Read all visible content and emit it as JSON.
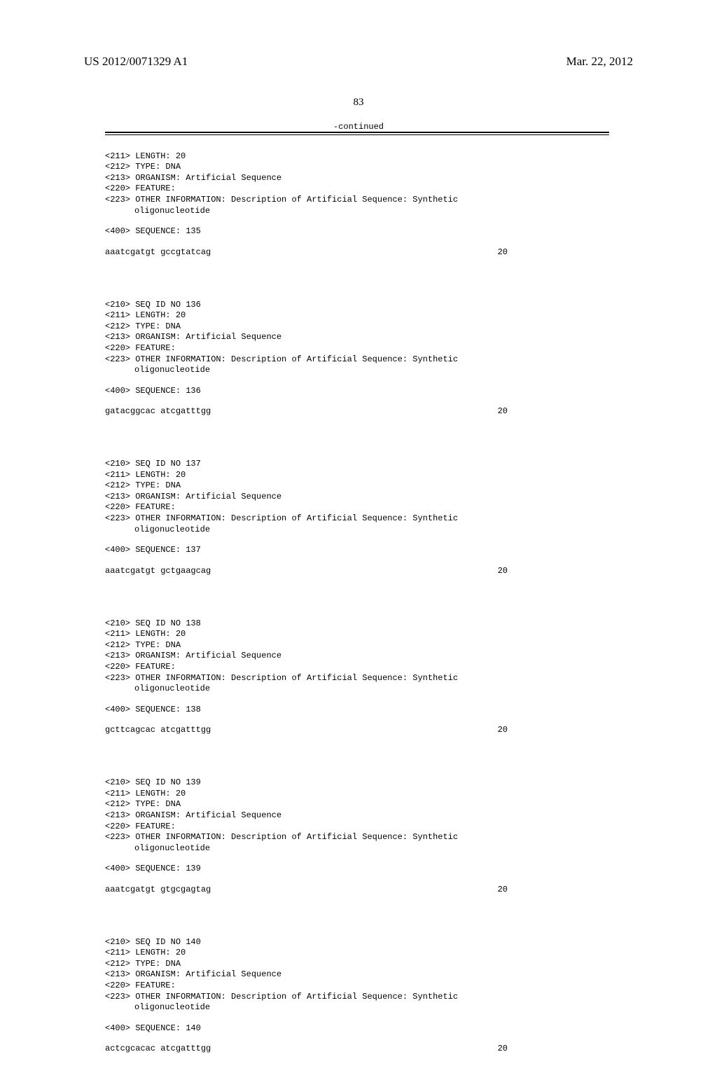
{
  "header": {
    "publication": "US 2012/0071329 A1",
    "date": "Mar. 22, 2012"
  },
  "page_number": "83",
  "continued_label": "-continued",
  "sequences": [
    {
      "has_seq_id": false,
      "length_line": "<211> LENGTH: 20",
      "type_line": "<212> TYPE: DNA",
      "organism_line": "<213> ORGANISM: Artificial Sequence",
      "feature_line": "<220> FEATURE:",
      "other_info_1": "<223> OTHER INFORMATION: Description of Artificial Sequence: Synthetic",
      "other_info_2": "oligonucleotide",
      "sequence_header": "<400> SEQUENCE: 135",
      "sequence_text": "aaatcgatgt gccgtatcag",
      "sequence_length": "20"
    },
    {
      "has_seq_id": true,
      "seq_id_line": "<210> SEQ ID NO 136",
      "length_line": "<211> LENGTH: 20",
      "type_line": "<212> TYPE: DNA",
      "organism_line": "<213> ORGANISM: Artificial Sequence",
      "feature_line": "<220> FEATURE:",
      "other_info_1": "<223> OTHER INFORMATION: Description of Artificial Sequence: Synthetic",
      "other_info_2": "oligonucleotide",
      "sequence_header": "<400> SEQUENCE: 136",
      "sequence_text": "gatacggcac atcgatttgg",
      "sequence_length": "20"
    },
    {
      "has_seq_id": true,
      "seq_id_line": "<210> SEQ ID NO 137",
      "length_line": "<211> LENGTH: 20",
      "type_line": "<212> TYPE: DNA",
      "organism_line": "<213> ORGANISM: Artificial Sequence",
      "feature_line": "<220> FEATURE:",
      "other_info_1": "<223> OTHER INFORMATION: Description of Artificial Sequence: Synthetic",
      "other_info_2": "oligonucleotide",
      "sequence_header": "<400> SEQUENCE: 137",
      "sequence_text": "aaatcgatgt gctgaagcag",
      "sequence_length": "20"
    },
    {
      "has_seq_id": true,
      "seq_id_line": "<210> SEQ ID NO 138",
      "length_line": "<211> LENGTH: 20",
      "type_line": "<212> TYPE: DNA",
      "organism_line": "<213> ORGANISM: Artificial Sequence",
      "feature_line": "<220> FEATURE:",
      "other_info_1": "<223> OTHER INFORMATION: Description of Artificial Sequence: Synthetic",
      "other_info_2": "oligonucleotide",
      "sequence_header": "<400> SEQUENCE: 138",
      "sequence_text": "gcttcagcac atcgatttgg",
      "sequence_length": "20"
    },
    {
      "has_seq_id": true,
      "seq_id_line": "<210> SEQ ID NO 139",
      "length_line": "<211> LENGTH: 20",
      "type_line": "<212> TYPE: DNA",
      "organism_line": "<213> ORGANISM: Artificial Sequence",
      "feature_line": "<220> FEATURE:",
      "other_info_1": "<223> OTHER INFORMATION: Description of Artificial Sequence: Synthetic",
      "other_info_2": "oligonucleotide",
      "sequence_header": "<400> SEQUENCE: 139",
      "sequence_text": "aaatcgatgt gtgcgagtag",
      "sequence_length": "20"
    },
    {
      "has_seq_id": true,
      "seq_id_line": "<210> SEQ ID NO 140",
      "length_line": "<211> LENGTH: 20",
      "type_line": "<212> TYPE: DNA",
      "organism_line": "<213> ORGANISM: Artificial Sequence",
      "feature_line": "<220> FEATURE:",
      "other_info_1": "<223> OTHER INFORMATION: Description of Artificial Sequence: Synthetic",
      "other_info_2": "oligonucleotide",
      "sequence_header": "<400> SEQUENCE: 140",
      "sequence_text": "actcgcacac atcgatttgg",
      "sequence_length": "20"
    }
  ]
}
